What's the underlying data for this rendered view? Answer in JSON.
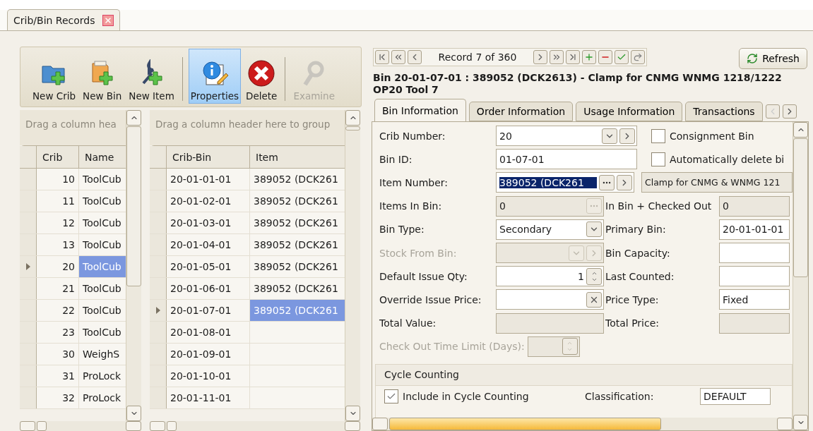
{
  "doc_tab": {
    "label": "Crib/Bin Records",
    "closable": true
  },
  "toolbar": [
    {
      "label": "New Crib",
      "kind": "new-crib",
      "selected": false,
      "disabled": false
    },
    {
      "label": "New Bin",
      "kind": "new-bin",
      "selected": false,
      "disabled": false
    },
    {
      "label": "New Item",
      "kind": "new-item",
      "selected": false,
      "disabled": false
    },
    {
      "label": "Properties",
      "kind": "properties",
      "selected": true,
      "disabled": false
    },
    {
      "label": "Delete",
      "kind": "delete",
      "selected": false,
      "disabled": false
    },
    {
      "label": "Examine",
      "kind": "examine",
      "selected": false,
      "disabled": true
    }
  ],
  "crib_grid": {
    "group_hint": "Drag a column hea",
    "columns": [
      "Crib",
      "Name"
    ],
    "rows": [
      {
        "cells": [
          "10",
          "ToolCub"
        ],
        "selected": false
      },
      {
        "cells": [
          "11",
          "ToolCub"
        ],
        "selected": false
      },
      {
        "cells": [
          "12",
          "ToolCub"
        ],
        "selected": false
      },
      {
        "cells": [
          "13",
          "ToolCub"
        ],
        "selected": false
      },
      {
        "cells": [
          "20",
          "ToolCub"
        ],
        "selected": true
      },
      {
        "cells": [
          "21",
          "ToolCub"
        ],
        "selected": false
      },
      {
        "cells": [
          "22",
          "ToolCub"
        ],
        "selected": false
      },
      {
        "cells": [
          "23",
          "ToolCub"
        ],
        "selected": false
      },
      {
        "cells": [
          "30",
          "WeighS"
        ],
        "selected": false
      },
      {
        "cells": [
          "31",
          "ProLock"
        ],
        "selected": false
      },
      {
        "cells": [
          "32",
          "ProLock"
        ],
        "selected": false
      }
    ]
  },
  "bin_grid": {
    "group_hint": "Drag a column header here to group",
    "columns": [
      "Crib-Bin",
      "Item"
    ],
    "rows": [
      {
        "cells": [
          "20-01-01-01",
          "389052 (DCK261"
        ],
        "selected": false
      },
      {
        "cells": [
          "20-01-02-01",
          "389052 (DCK261"
        ],
        "selected": false
      },
      {
        "cells": [
          "20-01-03-01",
          "389052 (DCK261"
        ],
        "selected": false
      },
      {
        "cells": [
          "20-01-04-01",
          "389052 (DCK261"
        ],
        "selected": false
      },
      {
        "cells": [
          "20-01-05-01",
          "389052 (DCK261"
        ],
        "selected": false
      },
      {
        "cells": [
          "20-01-06-01",
          "389052 (DCK261"
        ],
        "selected": false
      },
      {
        "cells": [
          "20-01-07-01",
          "389052 (DCK261"
        ],
        "selected": true
      },
      {
        "cells": [
          "20-01-08-01",
          ""
        ],
        "selected": false
      },
      {
        "cells": [
          "20-01-09-01",
          ""
        ],
        "selected": false
      },
      {
        "cells": [
          "20-01-10-01",
          ""
        ],
        "selected": false
      },
      {
        "cells": [
          "20-01-11-01",
          ""
        ],
        "selected": false
      }
    ]
  },
  "record_nav": {
    "text": "Record 7 of 360"
  },
  "refresh": {
    "label": "Refresh"
  },
  "bin_title": "Bin 20-01-07-01 : 389052 (DCK2613) - Clamp for CNMG  WNMG 1218/1222 OP20 Tool 7",
  "detail_tabs": [
    {
      "label": "Bin Information",
      "selected": true
    },
    {
      "label": "Order Information",
      "selected": false
    },
    {
      "label": "Usage Information",
      "selected": false
    },
    {
      "label": "Transactions",
      "selected": false
    }
  ],
  "form": [
    {
      "left": {
        "label": "Crib Number:",
        "value": "20",
        "kind": "combo-wide",
        "disabled": false
      },
      "right": {
        "kind": "checkbox",
        "label": "Consignment Bin",
        "checked": false
      }
    },
    {
      "left": {
        "label": "Bin ID:",
        "value": "01-07-01",
        "kind": "text-wide",
        "disabled": false
      },
      "right": {
        "kind": "checkbox",
        "label": "Automatically delete bi",
        "checked": false
      }
    },
    {
      "left": {
        "label": "Item Number:",
        "value": "389052 (DCK261",
        "kind": "lookup",
        "disabled": false
      },
      "right": {
        "kind": "description",
        "value": "Clamp for CNMG & WNMG 121"
      }
    },
    {
      "left": {
        "label": "Items In Bin:",
        "value": "0",
        "kind": "dots",
        "disabled": false
      },
      "right": {
        "kind": "field",
        "label": "In Bin + Checked Out",
        "value": "0",
        "readonly": true
      }
    },
    {
      "left": {
        "label": "Bin Type:",
        "value": "Secondary",
        "kind": "dropdown",
        "disabled": false
      },
      "right": {
        "kind": "field",
        "label": "Primary Bin:",
        "value": "20-01-01-01",
        "readonly": false
      }
    },
    {
      "left": {
        "label": "Stock From Bin:",
        "kind": "combo",
        "disabled": true
      },
      "right": {
        "kind": "field",
        "label": "Bin Capacity:",
        "readonly": false
      }
    },
    {
      "left": {
        "label": "Default Issue Qty:",
        "value": "1",
        "kind": "spin",
        "disabled": false
      },
      "right": {
        "kind": "field",
        "label": "Last Counted:",
        "readonly": false
      }
    },
    {
      "left": {
        "label": "Override Issue Price:",
        "kind": "clear",
        "disabled": false
      },
      "right": {
        "kind": "field",
        "label": "Price Type:",
        "value": "Fixed",
        "readonly": false
      }
    },
    {
      "left": {
        "label": "Total Value:",
        "kind": "readonly",
        "disabled": false
      },
      "right": {
        "kind": "field",
        "label": "Total Price:",
        "readonly": true
      }
    },
    {
      "left": {
        "label": "Check Out Time Limit (Days):",
        "kind": "spin-small",
        "disabled": true
      }
    }
  ],
  "cycle_counting": {
    "title": "Cycle Counting",
    "include": {
      "label": "Include in Cycle Counting",
      "checked": true
    },
    "classification_label": "Classification:",
    "classification_value": "DEFAULT"
  }
}
